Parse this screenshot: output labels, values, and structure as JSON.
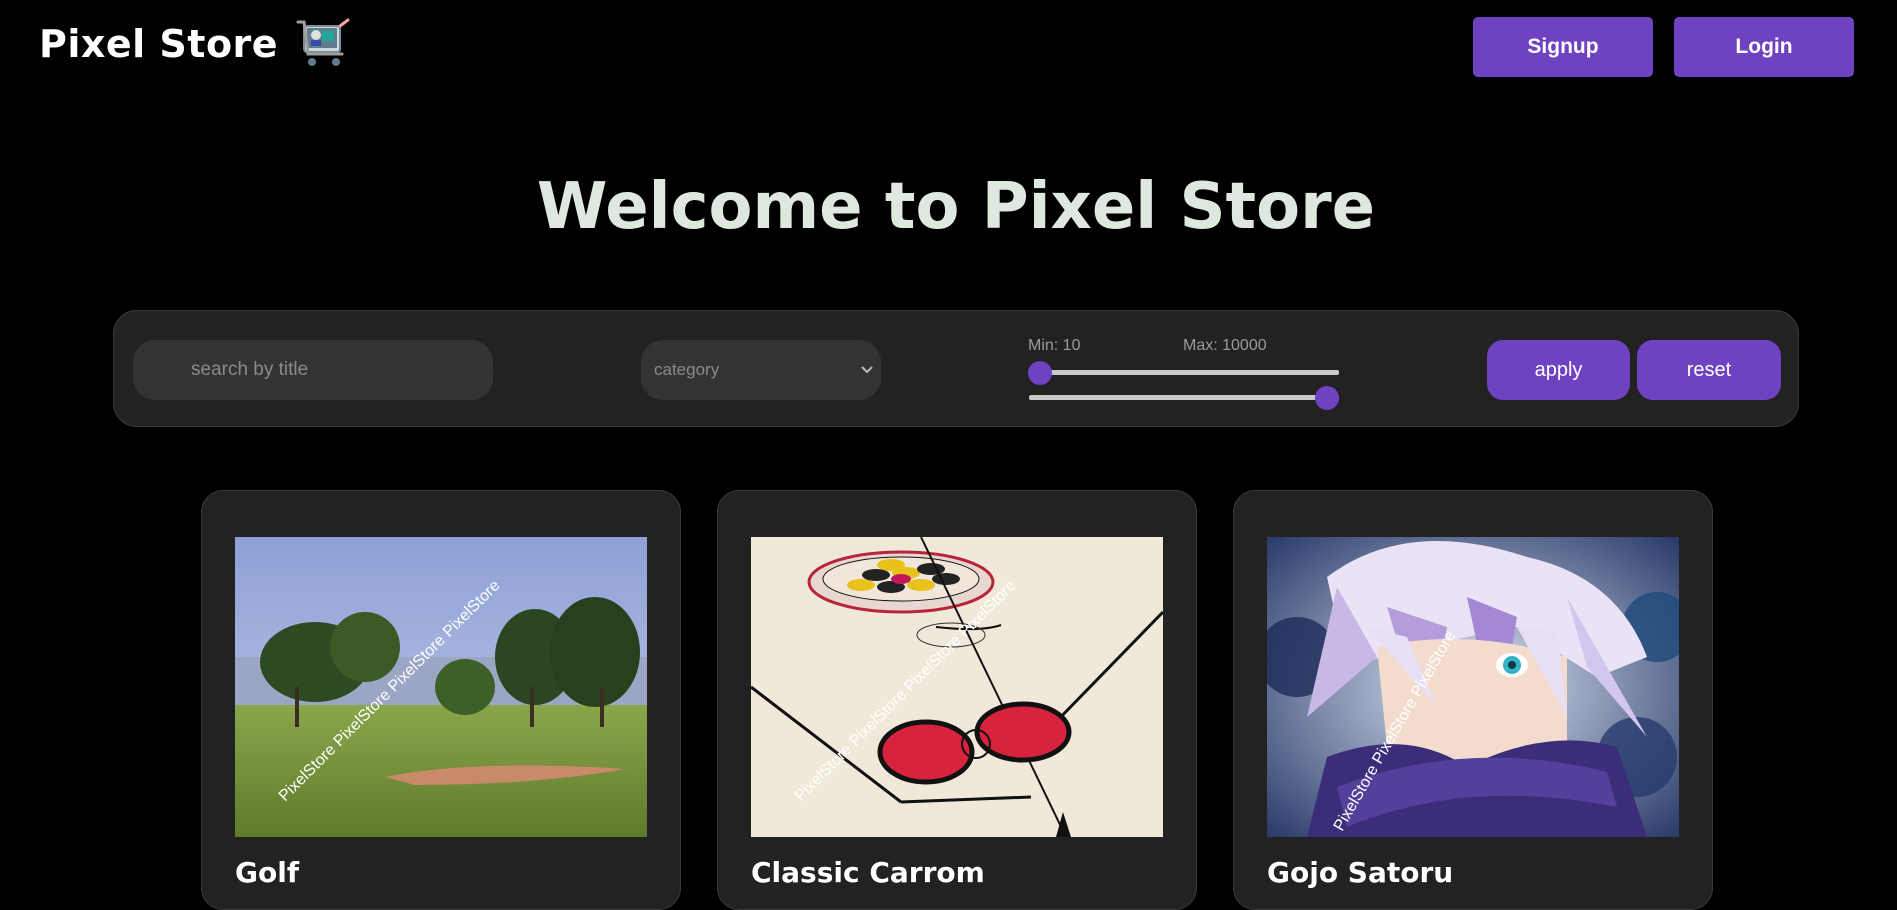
{
  "header": {
    "brand_title": "Pixel Store",
    "signup_label": "Signup",
    "login_label": "Login"
  },
  "hero": {
    "title": "Welcome to Pixel Store"
  },
  "filters": {
    "search_placeholder": "search by title",
    "category_value": "category",
    "min_label": "Min: 10",
    "max_label": "Max: 10000",
    "price_min": 10,
    "price_max": 10000,
    "apply_label": "apply",
    "reset_label": "reset"
  },
  "products": [
    {
      "title": "Golf",
      "image": "golf-course-photo",
      "watermark": "PixelStore PixelStore PixelStore PixelStore"
    },
    {
      "title": "Classic Carrom",
      "image": "carrom-board-photo",
      "watermark": "PixelStore PixelStore PixelStore PixelStore"
    },
    {
      "title": "Gojo Satoru",
      "image": "anime-character-illustration",
      "watermark": "PixelStore PixelStore PixelStore"
    }
  ],
  "colors": {
    "accent": "#6f42c1",
    "background": "#000000",
    "panel": "#222222",
    "input": "#333333",
    "hero_text": "#dfe8df"
  },
  "icons": {
    "brand": "shopping-cart-icon",
    "category": "chevron-down-icon"
  }
}
